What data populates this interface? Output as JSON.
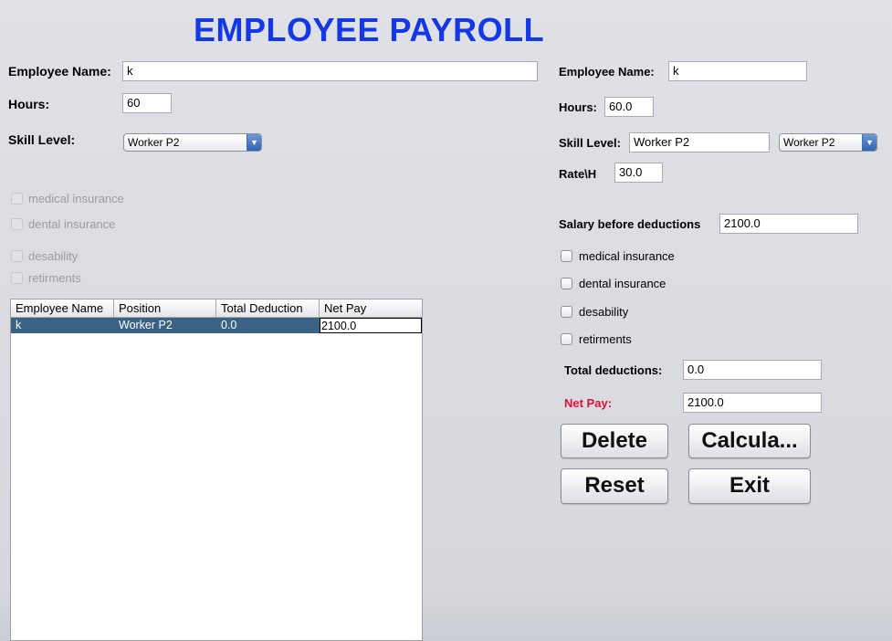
{
  "title": "EMPLOYEE PAYROLL",
  "left": {
    "employee_name_label": "Employee Name:",
    "employee_name_value": "k",
    "hours_label": "Hours:",
    "hours_value": "60",
    "skill_label": "Skill Level:",
    "skill_selected": "Worker P2",
    "checkboxes": [
      "medical insurance",
      "dental insurance",
      "desability",
      "retirments"
    ]
  },
  "table": {
    "columns": [
      "Employee Name",
      "Position",
      "Total Deduction",
      "Net Pay"
    ],
    "rows": [
      {
        "name": "k",
        "position": "Worker P2",
        "total_deduction": "0.0",
        "net_pay": "2100.0"
      }
    ]
  },
  "right": {
    "employee_name_label": "Employee Name:",
    "employee_name_value": "k",
    "hours_label": "Hours:",
    "hours_value": "60.0",
    "skill_label": "Skill Level:",
    "skill_value": "Worker P2",
    "skill_selected": "Worker P2",
    "rate_label": "Rate\\H",
    "rate_value": "30.0",
    "salary_label": "Salary before deductions",
    "salary_value": "2100.0",
    "checkboxes": [
      "medical insurance",
      "dental insurance",
      "desability",
      "retirments"
    ],
    "total_deductions_label": "Total deductions:",
    "total_deductions_value": "0.0",
    "net_pay_label": "Net Pay:",
    "net_pay_value": "2100.0"
  },
  "buttons": {
    "delete": "Delete",
    "calculate": "Calcula...",
    "reset": "Reset",
    "exit": "Exit"
  },
  "colors": {
    "title": "#1438e8",
    "net_pay_label": "#e0103a",
    "selected_row": "#3a6285"
  }
}
